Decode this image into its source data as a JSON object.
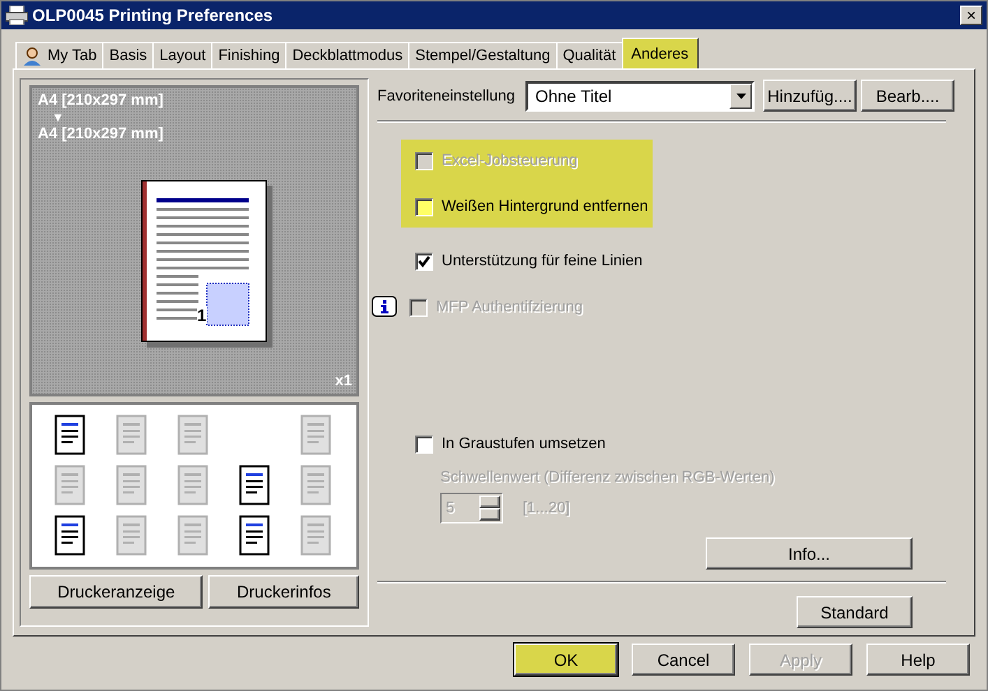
{
  "window": {
    "title": "OLP0045 Printing Preferences",
    "close": "×"
  },
  "tabs": [
    {
      "label": "My Tab",
      "selected": false,
      "highlighted": false,
      "kind": "user"
    },
    {
      "label": "Basis",
      "selected": false,
      "highlighted": false
    },
    {
      "label": "Layout",
      "selected": false,
      "highlighted": false
    },
    {
      "label": "Finishing",
      "selected": false,
      "highlighted": false
    },
    {
      "label": "Deckblattmodus",
      "selected": false,
      "highlighted": false
    },
    {
      "label": "Stempel/Gestaltung",
      "selected": false,
      "highlighted": false
    },
    {
      "label": "Qualität",
      "selected": false,
      "highlighted": false
    },
    {
      "label": "Anderes",
      "selected": true,
      "highlighted": true
    }
  ],
  "preview": {
    "source_size": "A4 [210x297 mm]",
    "arrow": "▼",
    "output_size": "A4 [210x297 mm]",
    "page_number": "1",
    "copies": "x1"
  },
  "icon_grid": [
    {
      "kind": "icon",
      "enabled": true
    },
    {
      "kind": "icon",
      "enabled": false
    },
    {
      "kind": "icon",
      "enabled": false
    },
    {
      "kind": "blank"
    },
    {
      "kind": "icon",
      "enabled": false
    },
    {
      "kind": "icon",
      "enabled": false
    },
    {
      "kind": "icon",
      "enabled": false
    },
    {
      "kind": "icon",
      "enabled": false
    },
    {
      "kind": "icon",
      "enabled": true
    },
    {
      "kind": "icon",
      "enabled": false
    },
    {
      "kind": "icon",
      "enabled": true
    },
    {
      "kind": "icon",
      "enabled": false
    },
    {
      "kind": "icon",
      "enabled": false
    },
    {
      "kind": "icon",
      "enabled": true
    },
    {
      "kind": "icon",
      "enabled": false
    }
  ],
  "left_buttons": [
    "Druckeranzeige",
    "Druckerinfos"
  ],
  "favorites": {
    "label": "Favoriteneinstellung",
    "value": "Ohne Titel",
    "buttons": [
      "Hinzufüg....",
      "Bearb...."
    ]
  },
  "options": [
    {
      "label": "Excel-Jobsteuerung",
      "checked": false,
      "disabled": true,
      "highlighted": true,
      "info": false
    },
    {
      "label": "Weißen Hintergrund entfernen",
      "checked": false,
      "disabled": false,
      "highlighted": true,
      "info": false
    },
    {
      "label": "Unterstützung für feine Linien",
      "checked": true,
      "disabled": false,
      "highlighted": false,
      "info": false
    },
    {
      "label": "MFP Authentifzierung",
      "checked": false,
      "disabled": true,
      "highlighted": false,
      "info": true
    }
  ],
  "grayscale": {
    "label": "In Graustufen umsetzen",
    "checked": false,
    "disabled": false,
    "threshold_label": "Schwellenwert (Differenz zwischen RGB-Werten)",
    "threshold_value": "5",
    "range": "[1...20]",
    "threshold_disabled": true
  },
  "info_button": "Info...",
  "standard_button": "Standard",
  "dialog_buttons": [
    {
      "label": "OK",
      "disabled": false,
      "highlighted": true
    },
    {
      "label": "Cancel",
      "disabled": false,
      "highlighted": false
    },
    {
      "label": "Apply",
      "disabled": true,
      "highlighted": false
    },
    {
      "label": "Help",
      "disabled": false,
      "highlighted": false
    }
  ]
}
